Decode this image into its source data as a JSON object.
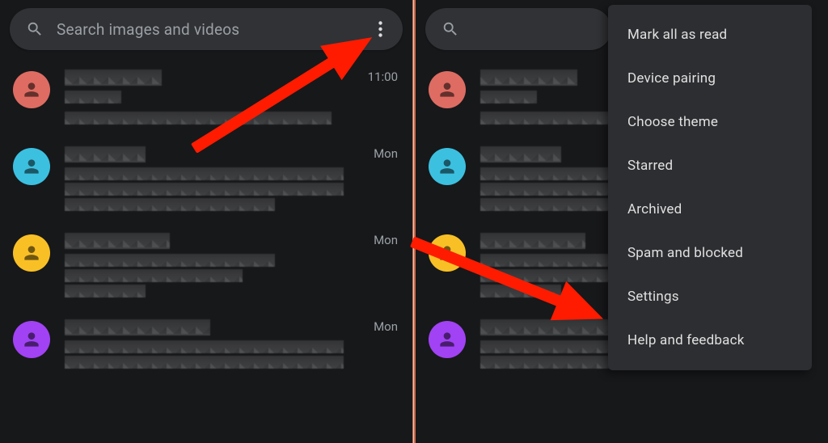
{
  "search": {
    "placeholder": "Search images and videos"
  },
  "left": {
    "conversations": [
      {
        "avatar": "red",
        "time": "11:00"
      },
      {
        "avatar": "blue",
        "time": "Mon"
      },
      {
        "avatar": "yellow",
        "time": "Mon"
      },
      {
        "avatar": "purple",
        "time": "Mon"
      }
    ]
  },
  "menu": {
    "items": [
      "Mark all as read",
      "Device pairing",
      "Choose theme",
      "Starred",
      "Archived",
      "Spam and blocked",
      "Settings",
      "Help and feedback"
    ]
  },
  "annotations": {
    "arrow1_target": "more-button",
    "arrow2_target": "menu-item-spam-and-blocked"
  },
  "colors": {
    "bg": "#17181a",
    "searchBar": "#313235",
    "menu": "#2d2e31",
    "text": "#e0e0e0",
    "muted": "#9aa0a6",
    "arrow": "#ff1b00",
    "avatars": {
      "red": "#de6c62",
      "blue": "#3cc0e0",
      "yellow": "#f9c026",
      "purple": "#a142f4"
    }
  }
}
